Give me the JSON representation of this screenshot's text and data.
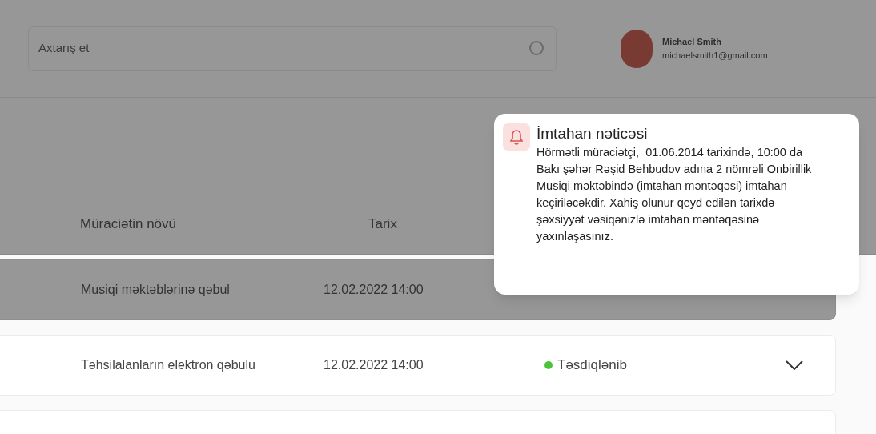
{
  "search": {
    "placeholder": "Axtarış et"
  },
  "user": {
    "name": "Michael Smith",
    "email": "michaelsmith1@gmail.com"
  },
  "table": {
    "columns": [
      "Müraciətin növü",
      "Tarix"
    ],
    "rows": [
      {
        "type": "Musiqi məktəblərinə qəbul",
        "date": "12.02.2022 14:00",
        "dimmed": true
      },
      {
        "type": "Təhsilalanların elektron qəbulu",
        "date": "12.02.2022 14:00",
        "dimmed": false,
        "status": {
          "label": "Təsdiqlənib",
          "color": "#4cc33a"
        }
      },
      {
        "dimmed": false
      }
    ]
  },
  "notification": {
    "title": "İmtahan nəticəsi",
    "body": "Hörmətli müraciətçi,  01.06.2014 tarixində, 10:00 da Bakı şəhər Rəşid Behbudov adına 2 nömrəli Onbirillik Musiqi məktəbində (imtahan məntəqəsi) imtahan keçiriləcəkdir. Xahiş olunur qeyd edilən tarixdə şəxsiyyət vəsiqənizlə imtahan məntəqəsinə yaxınlaşasınız."
  }
}
